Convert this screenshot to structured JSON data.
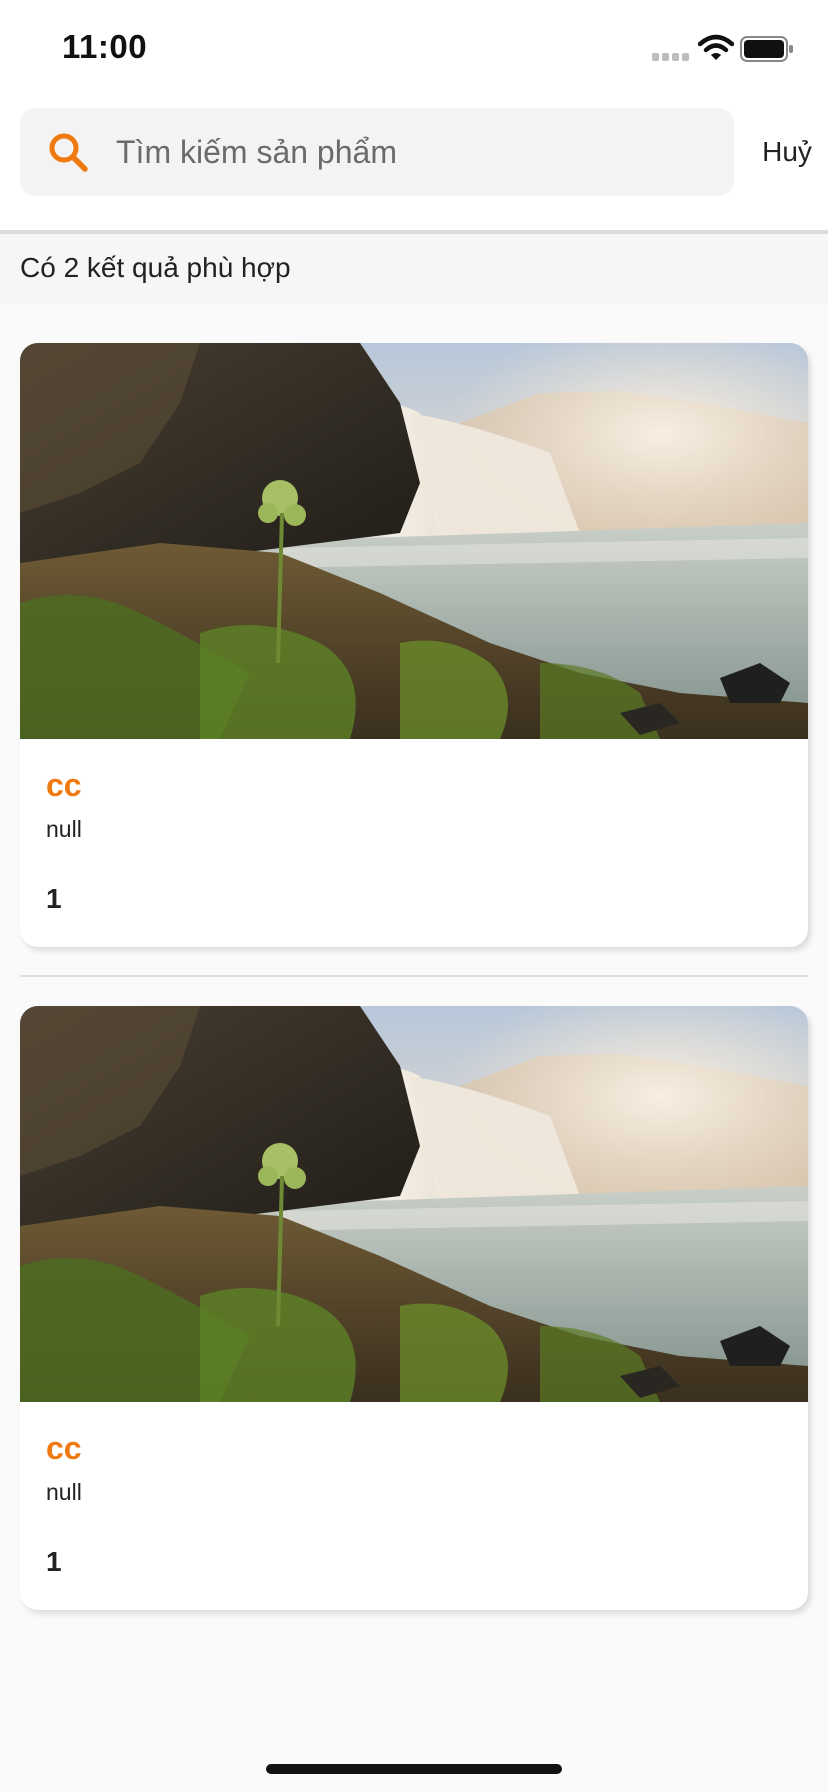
{
  "status_bar": {
    "time": "11:00",
    "icons": [
      "cellular-signal-icon",
      "wifi-icon",
      "battery-icon"
    ]
  },
  "search": {
    "placeholder": "Tìm kiếm sản phẩm",
    "value": "",
    "icon": "search-icon",
    "cancel_label": "Huỷ"
  },
  "results": {
    "summary": "Có 2 kết quả phù hợp"
  },
  "products": [
    {
      "title": "cc",
      "description": "null",
      "price": "1",
      "image": "waterfall-landscape-photo"
    },
    {
      "title": "cc",
      "description": "null",
      "price": "1",
      "image": "waterfall-landscape-photo"
    }
  ],
  "colors": {
    "accent": "#f07a12",
    "background": "#fafafa",
    "search_box": "#f3f3f3"
  }
}
